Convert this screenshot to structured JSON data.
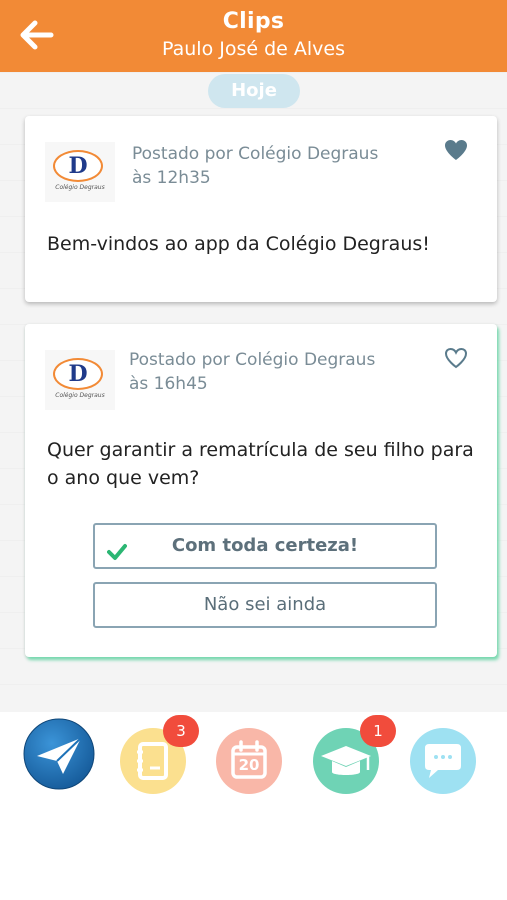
{
  "header": {
    "title": "Clips",
    "subtitle": "Paulo José de Alves"
  },
  "feed": {
    "date_label": "Hoje",
    "posts": [
      {
        "logo_letter": "D",
        "logo_caption": "Colégio Degraus",
        "posted_by": "Postado por Colégio Degraus",
        "time": "às 12h35",
        "message": "Bem-vindos ao app da Colégio Degraus!",
        "liked": true
      },
      {
        "logo_letter": "D",
        "logo_caption": "Colégio Degraus",
        "posted_by": "Postado por Colégio Degraus",
        "time": "às 16h45",
        "message": "Quer garantir a rematrícula de seu filho para o ano que vem?",
        "liked": false,
        "options": [
          {
            "label": "Com toda certeza!",
            "selected": true
          },
          {
            "label": "Não sei ainda",
            "selected": false
          }
        ]
      }
    ]
  },
  "bottom_nav": [
    {
      "name": "send-icon",
      "color": "#1d72b8"
    },
    {
      "name": "notebook-icon",
      "color": "#fbe08f",
      "badge": "3"
    },
    {
      "name": "calendar-icon",
      "color": "#f9b7a8",
      "label": "20"
    },
    {
      "name": "graduation-cap-icon",
      "color": "#6fd3b5",
      "badge": "1"
    },
    {
      "name": "chat-icon",
      "color": "#9ee1f2"
    }
  ],
  "colors": {
    "accent": "#f28a36",
    "badge": "#f14c3c",
    "heart": "#5a7b8c",
    "check": "#2bb673"
  }
}
